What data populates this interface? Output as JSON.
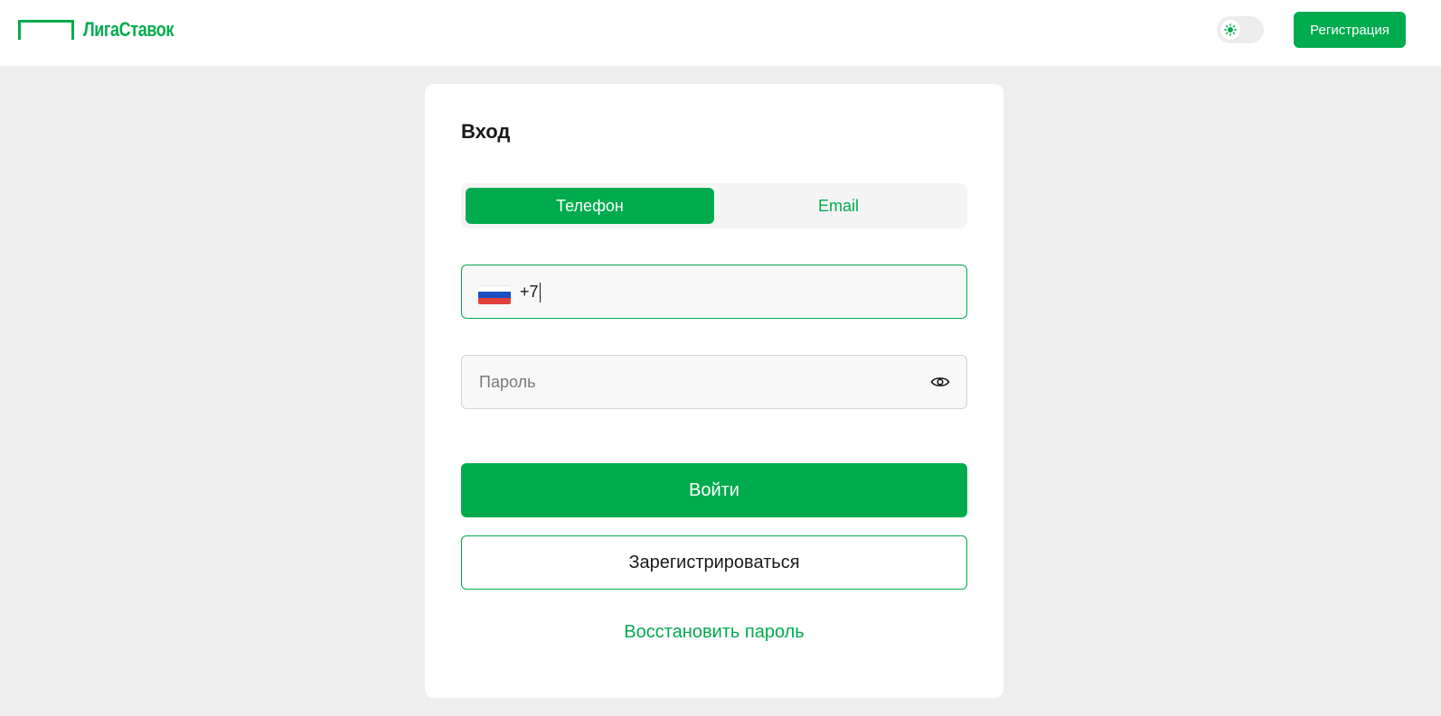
{
  "header": {
    "logo_text": "ЛигаСтавок",
    "register_label": "Регистрация"
  },
  "colors": {
    "brand": "#00ab4e",
    "page_bg": "#eeeeee",
    "card_bg": "#ffffff"
  },
  "theme_toggle": {
    "icon": "sun-icon",
    "state": "light"
  },
  "login": {
    "title": "Вход",
    "tabs": [
      {
        "label": "Телефон",
        "active": true
      },
      {
        "label": "Email",
        "active": false
      }
    ],
    "phone": {
      "country_icon": "russia-flag-icon",
      "value": "+7"
    },
    "password": {
      "placeholder": "Пароль",
      "toggle_icon": "eye-icon"
    },
    "submit_label": "Войти",
    "signup_label": "Зарегистрироваться",
    "restore_label": "Восстановить пароль"
  }
}
